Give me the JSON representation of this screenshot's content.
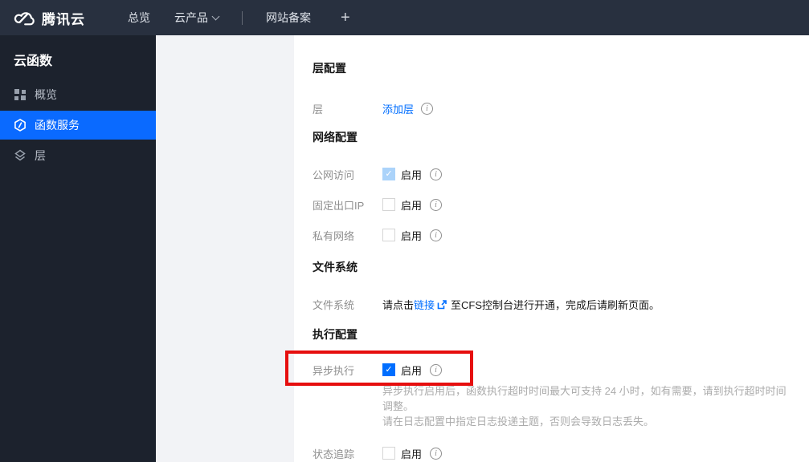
{
  "topnav": {
    "brand": "腾讯云",
    "overview_label": "总览",
    "products_label": "云产品",
    "icp_label": "网站备案",
    "plus_label": "+"
  },
  "sidebar": {
    "title": "云函数",
    "items": [
      {
        "label": "概览",
        "icon": "grid-overview-icon",
        "active": false
      },
      {
        "label": "函数服务",
        "icon": "function-hexagon-icon",
        "active": true
      },
      {
        "label": "层",
        "icon": "layers-icon",
        "active": false
      }
    ]
  },
  "content": {
    "layer_section": {
      "heading": "层配置",
      "row_label": "层",
      "add_layer_link": "添加层"
    },
    "network_section": {
      "heading": "网络配置",
      "rows": [
        {
          "label": "公网访问",
          "checkbox_state": "checked-disabled",
          "enable_label": "启用"
        },
        {
          "label": "固定出口IP",
          "checkbox_state": "unchecked",
          "enable_label": "启用"
        },
        {
          "label": "私有网络",
          "checkbox_state": "unchecked",
          "enable_label": "启用"
        }
      ]
    },
    "filesystem_section": {
      "heading": "文件系统",
      "row_label": "文件系统",
      "text_before_link": "请点击",
      "link_label": "链接",
      "text_after_link": "至CFS控制台进行开通，完成后请刷新页面。"
    },
    "execution_section": {
      "heading": "执行配置",
      "async_row": {
        "label": "异步执行",
        "checkbox_state": "checked",
        "enable_label": "启用",
        "help_line1": "异步执行启用后，函数执行超时时间最大可支持 24 小时，如有需要，请到执行超时时间调整。",
        "help_line2": "请在日志配置中指定日志投递主题，否则会导致日志丢失。"
      },
      "trace_row": {
        "label": "状态追踪",
        "checkbox_state": "unchecked",
        "enable_label": "启用"
      }
    }
  },
  "icons": {
    "check": "✓",
    "info": "i"
  },
  "colors": {
    "topnav_bg": "#28303f",
    "sidebar_bg": "#1c222d",
    "sidebar_active_bg": "#0a6aff",
    "link_blue": "#006eff",
    "checkbox_checked": "#006eff",
    "checkbox_checked_disabled": "#abd3fa",
    "annotation_red": "#e60e0e",
    "gray_panel_bg": "#f2f3f6"
  }
}
